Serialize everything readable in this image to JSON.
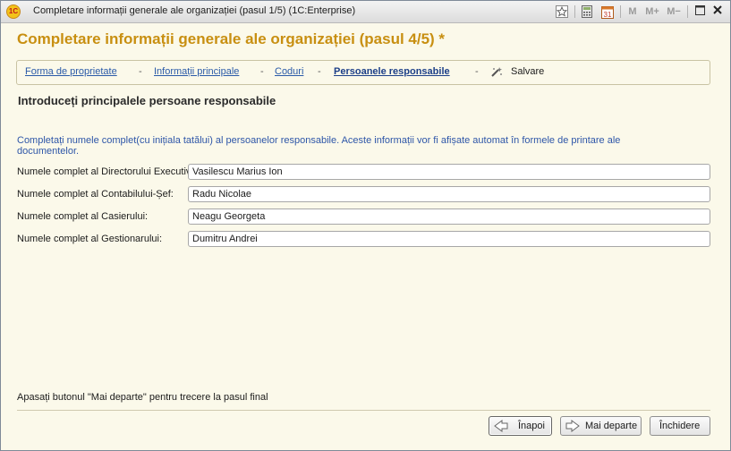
{
  "window": {
    "title": "Completare informații generale ale organizației (pasul 1/5)  (1C:Enterprise)",
    "logo_text": "1C",
    "toolbar": {
      "m": "M",
      "m_plus": "M+",
      "m_minus": "M−",
      "calendar_day": "31"
    }
  },
  "form": {
    "title": "Completare informații generale ale organizației (pasul 4/5) *",
    "steps": [
      {
        "label": "Forma de proprietate"
      },
      {
        "label": "Informații principale"
      },
      {
        "label": "Coduri"
      },
      {
        "label": "Persoanele responsabile"
      },
      {
        "label": "Salvare"
      }
    ],
    "step_separator": "-",
    "section_title": "Introduceți principalele persoane responsabile",
    "info_text": "Completați numele complet(cu inițiala tatălui) al persoanelor responsabile. Aceste informații vor fi afișate automat în formele de printare ale documentelor.",
    "fields": [
      {
        "label": "Numele complet al Directorului Executiv:",
        "value": "Vasilescu Marius Ion"
      },
      {
        "label": "Numele complet al Contabilului-Șef:",
        "value": "Radu Nicolae"
      },
      {
        "label": "Numele complet al Casierului:",
        "value": "Neagu Georgeta"
      },
      {
        "label": "Numele complet al Gestionarului:",
        "value": "Dumitru Andrei"
      }
    ],
    "hint": "Apasați butonul \"Mai departe\" pentru trecere la pasul final",
    "buttons": {
      "back": "Înapoi",
      "next": "Mai departe",
      "close": "Închidere"
    }
  }
}
